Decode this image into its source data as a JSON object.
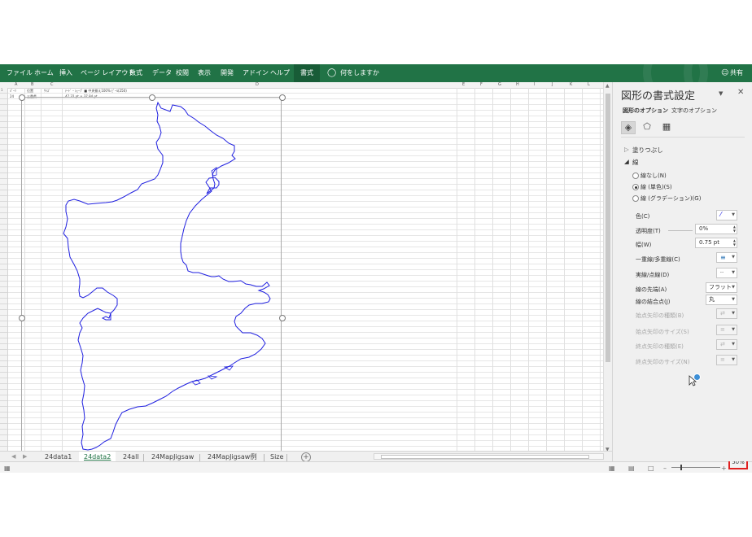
{
  "ribbon": {
    "tabs": [
      "ファイル",
      "ホーム",
      "挿入",
      "ページ レイアウト",
      "数式",
      "データ",
      "校閲",
      "表示",
      "開発",
      "アドイン",
      "ヘルプ"
    ],
    "active_tab": "書式",
    "tell_me": "何をしますか",
    "share": "共有"
  },
  "sheet": {
    "columns": [
      "A",
      "B",
      "C",
      "D",
      "E",
      "F",
      "G",
      "H",
      "I",
      "J",
      "K",
      "L"
    ],
    "row1": [
      "ﾊﾟｰﾂ",
      "位置",
      "ｻｲｽﾞ",
      "ﾃｰﾄﾞ・ｼｪｰﾌﾟ  ■ 中央揃え100%  ﾋﾟｰﾙ(250)"
    ],
    "row2": [
      "24",
      "三重県",
      "",
      "47.32 pt   ×   37.84 pt"
    ],
    "row_numbers_first": "1",
    "row_numbers_last": "62"
  },
  "sheet_tabs": {
    "tabs": [
      "24data1",
      "24data2",
      "24all",
      "24MapJigsaw",
      "24MapJigsaw例",
      "Size"
    ],
    "active": "24data2"
  },
  "status": {
    "zoom": "50%"
  },
  "pane": {
    "title": "図形の書式設定",
    "tab_shape": "図形のオプション",
    "tab_text": "文字のオプション",
    "fill": "塗りつぶし",
    "line": "線",
    "radio_none": "線なし(N)",
    "radio_solid": "線 (単色)(S)",
    "radio_gradient": "線 (グラデーション)(G)",
    "color": "色(C)",
    "transparency": "透明度(T)",
    "transparency_value": "0%",
    "width": "幅(W)",
    "width_value": "0.75 pt",
    "compound": "一重線/多重線(C)",
    "dash": "実線/点線(D)",
    "cap": "線の先端(A)",
    "cap_value": "フラット",
    "join": "線の結合点(J)",
    "join_value": "丸",
    "begin_arrow_type": "始点矢印の種類(B)",
    "begin_arrow_size": "始点矢印のサイズ(S)",
    "end_arrow_type": "終点矢印の種類(E)",
    "end_arrow_size": "終点矢印のサイズ(N)"
  },
  "colors": {
    "excel_green": "#217346",
    "outline_blue": "#1f1fe0",
    "highlight_red": "#e02020"
  }
}
